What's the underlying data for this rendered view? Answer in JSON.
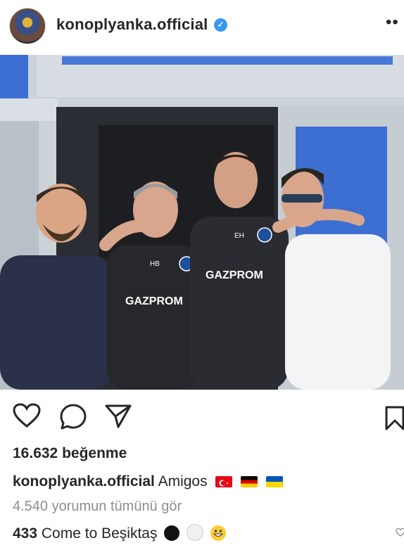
{
  "post": {
    "username": "konoplyanka.official",
    "verified_mark": "✓",
    "more_label": "••",
    "photo": {
      "shirt_sponsor_1": "GAZPROM",
      "shirt_sponsor_2": "GAZPROM",
      "shirt_initials_1": "HB",
      "shirt_initials_2": "EH"
    },
    "likes": "16.632 beğenme",
    "caption": {
      "username": "konoplyanka.official",
      "text": "Amigos"
    },
    "view_comments": "4.540 yorumun tümünü gör",
    "comment": {
      "username": "433",
      "text": "Come to Beşiktaş"
    }
  },
  "icons": [
    "heart-icon",
    "comment-icon",
    "share-icon",
    "bookmark-icon",
    "small-heart-icon"
  ],
  "colors": {
    "verified": "#3897f0",
    "text": "#262626",
    "muted": "#8e8e8e"
  }
}
